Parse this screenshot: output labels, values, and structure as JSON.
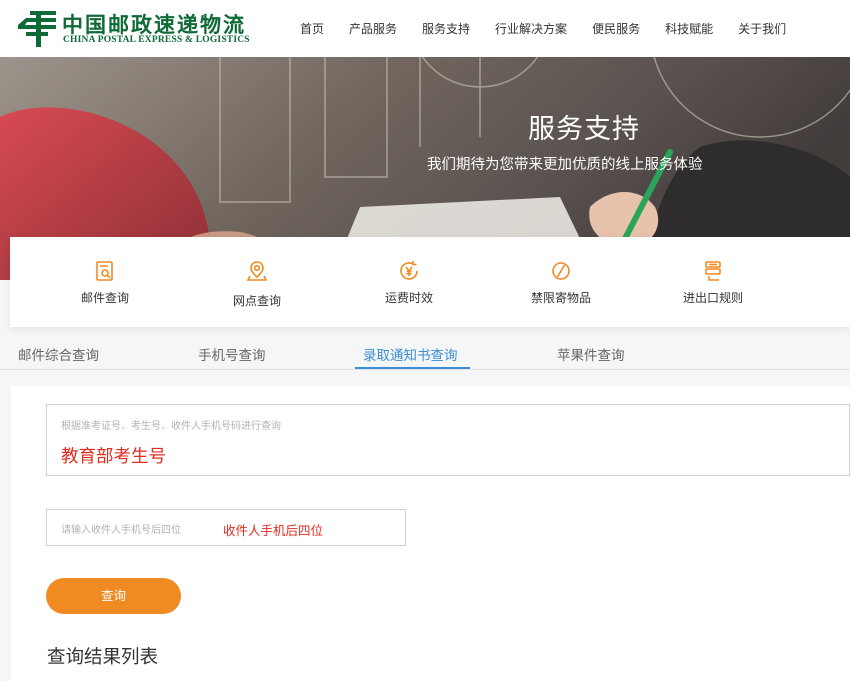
{
  "header": {
    "logo_cn": "中国邮政速递物流",
    "logo_en": "CHINA POSTAL EXPRESS & LOGISTICS",
    "nav": [
      "首页",
      "产品服务",
      "服务支持",
      "行业解决方案",
      "便民服务",
      "科技赋能",
      "关于我们"
    ]
  },
  "banner": {
    "title": "服务支持",
    "subtitle": "我们期待为您带来更加优质的线上服务体验"
  },
  "services": [
    {
      "label": "邮件查询",
      "icon": "mail-search-icon"
    },
    {
      "label": "网点查询",
      "icon": "location-icon"
    },
    {
      "label": "运费时效",
      "icon": "yen-clock-icon"
    },
    {
      "label": "禁限寄物品",
      "icon": "prohibited-icon"
    },
    {
      "label": "进出口规则",
      "icon": "customs-rules-icon"
    }
  ],
  "tabs": [
    {
      "label": "邮件综合查询",
      "active": false
    },
    {
      "label": "手机号查询",
      "active": false
    },
    {
      "label": "录取通知书查询",
      "active": true
    },
    {
      "label": "苹果件查询",
      "active": false
    }
  ],
  "form": {
    "exam_field_placeholder": "根据准考证号、考生号、收件人手机号码进行查询",
    "exam_field_value": "教育部考生号",
    "phone_field_placeholder": "请输入收件人手机号后四位",
    "phone_field_value": "收件人手机后四位",
    "query_button": "查询"
  },
  "results": {
    "title": "查询结果列表"
  },
  "colors": {
    "brand_green": "#0f6a37",
    "accent_blue": "#3a8ed8",
    "button_orange": "#f08a22",
    "service_icon_orange": "#f08a22",
    "annotation_red": "#e02b20"
  }
}
